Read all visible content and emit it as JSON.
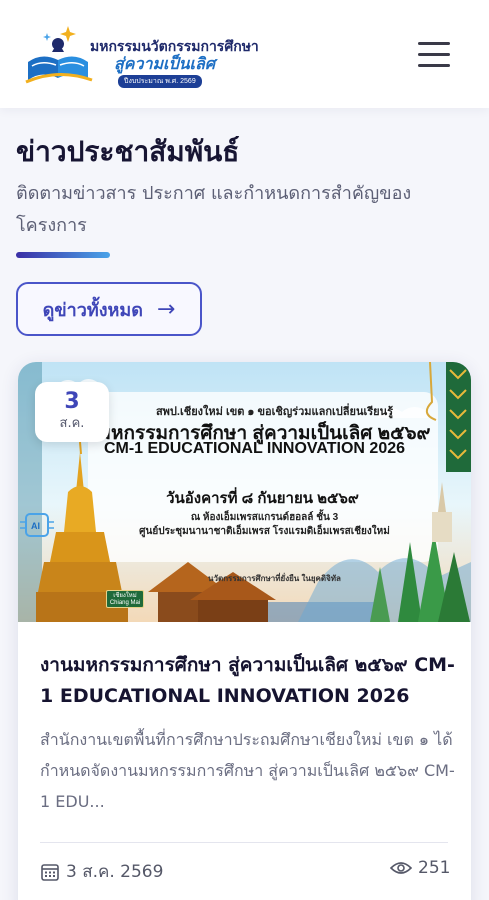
{
  "header": {
    "logo": {
      "line1": "มหกรรมนวัตกรรมการศึกษา",
      "line2": "สู่ความเป็นเลิศ",
      "badge": "ปีงบประมาณ พ.ศ. 2569"
    },
    "menu_icon": "hamburger-menu-icon"
  },
  "news": {
    "title": "ข่าวประชาสัมพันธ์",
    "subtitle": "ติดตามข่าวสาร ประกาศ และกำหนดการสำคัญของโครงการ",
    "view_all_label": "ดูข่าวทั้งหมด",
    "view_all_icon": "arrow-right-icon",
    "accent_colors": [
      "#3b2fa6",
      "#4aa3e8"
    ],
    "cards": [
      {
        "date_day": "3",
        "date_month": "ส.ค.",
        "banner": {
          "line1": "สพป.เชียงใหม่ เขต ๑ ขอเชิญร่วมแลกเปลี่ยนเรียนรู้",
          "line2": "มหกรรมการศึกษา สู่ความเป็นเลิศ ๒๕๖๙",
          "line3": "CM-1 EDUCATIONAL INNOVATION 2026",
          "line4": "วันอังคารที่ ๘ กันยายน ๒๕๖๙",
          "line5": "ณ ห้องเอ็มเพรสแกรนด์ฮอลล์ ชั้น 3",
          "line6": "ศูนย์ประชุมนานาชาติเอ็มเพรส โรงแรมดิเอ็มเพรสเชียงใหม่",
          "line7": "นวัตกรรมการศึกษาที่ยั่งยืน ในยุคดิจิทัล",
          "sign": "เชียงใหม่ Chiang Mai",
          "ai_label": "AI"
        },
        "title": "งานมหกรรมการศึกษา สู่ความเป็นเลิศ ๒๕๖๙ CM-1 EDUCATIONAL INNOVATION 2026",
        "description": "สำนักงานเขตพื้นที่การศึกษาประถมศึกษาเชียงใหม่ เขต ๑ ได้กำหนดจัดงานมหกรรมการศึกษา สู่ความเป็นเลิศ ๒๕๖๙ CM-1 EDU...",
        "date_label": "3 ส.ค. 2569",
        "date_icon": "calendar-icon",
        "views": "251",
        "views_icon": "eye-icon"
      }
    ]
  }
}
